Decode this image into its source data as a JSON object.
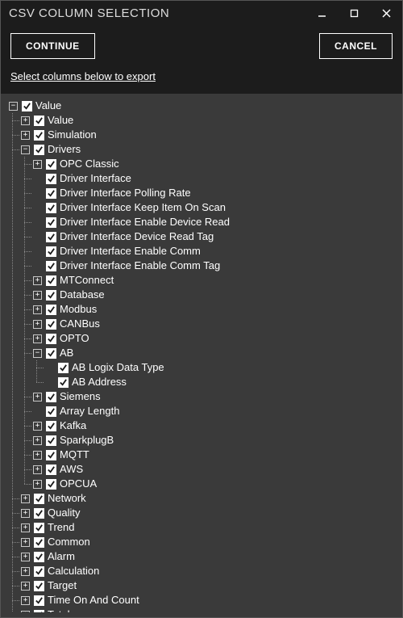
{
  "window": {
    "title": "CSV COLUMN SELECTION"
  },
  "buttons": {
    "continue": "CONTINUE",
    "cancel": "CANCEL"
  },
  "instruction": "Select columns below to export",
  "tree": [
    {
      "label": "Value",
      "checked": true,
      "expanded": true,
      "children": [
        {
          "label": "Value",
          "checked": true,
          "expandable": true,
          "expanded": false
        },
        {
          "label": "Simulation",
          "checked": true,
          "expandable": true,
          "expanded": false
        },
        {
          "label": "Drivers",
          "checked": true,
          "expanded": true,
          "children": [
            {
              "label": "OPC Classic",
              "checked": true,
              "expandable": true,
              "expanded": false
            },
            {
              "label": "Driver Interface",
              "checked": true
            },
            {
              "label": "Driver Interface Polling Rate",
              "checked": true
            },
            {
              "label": "Driver Interface Keep Item On Scan",
              "checked": true
            },
            {
              "label": "Driver Interface Enable Device Read",
              "checked": true
            },
            {
              "label": "Driver Interface Device Read Tag",
              "checked": true
            },
            {
              "label": "Driver Interface Enable Comm",
              "checked": true
            },
            {
              "label": "Driver Interface Enable Comm Tag",
              "checked": true
            },
            {
              "label": "MTConnect",
              "checked": true,
              "expandable": true,
              "expanded": false
            },
            {
              "label": "Database",
              "checked": true,
              "expandable": true,
              "expanded": false
            },
            {
              "label": "Modbus",
              "checked": true,
              "expandable": true,
              "expanded": false
            },
            {
              "label": "CANBus",
              "checked": true,
              "expandable": true,
              "expanded": false
            },
            {
              "label": "OPTO",
              "checked": true,
              "expandable": true,
              "expanded": false
            },
            {
              "label": "AB",
              "checked": true,
              "expanded": true,
              "children": [
                {
                  "label": "AB Logix Data Type",
                  "checked": true
                },
                {
                  "label": "AB Address",
                  "checked": true
                }
              ]
            },
            {
              "label": "Siemens",
              "checked": true,
              "expandable": true,
              "expanded": false
            },
            {
              "label": "Array Length",
              "checked": true
            },
            {
              "label": "Kafka",
              "checked": true,
              "expandable": true,
              "expanded": false
            },
            {
              "label": "SparkplugB",
              "checked": true,
              "expandable": true,
              "expanded": false
            },
            {
              "label": "MQTT",
              "checked": true,
              "expandable": true,
              "expanded": false
            },
            {
              "label": "AWS",
              "checked": true,
              "expandable": true,
              "expanded": false
            },
            {
              "label": "OPCUA",
              "checked": true,
              "expandable": true,
              "expanded": false
            }
          ]
        },
        {
          "label": "Network",
          "checked": true,
          "expandable": true,
          "expanded": false
        },
        {
          "label": "Quality",
          "checked": true,
          "expandable": true,
          "expanded": false
        },
        {
          "label": "Trend",
          "checked": true,
          "expandable": true,
          "expanded": false
        },
        {
          "label": "Common",
          "checked": true,
          "expandable": true,
          "expanded": false
        },
        {
          "label": "Alarm",
          "checked": true,
          "expandable": true,
          "expanded": false
        },
        {
          "label": "Calculation",
          "checked": true,
          "expandable": true,
          "expanded": false
        },
        {
          "label": "Target",
          "checked": true,
          "expandable": true,
          "expanded": false
        },
        {
          "label": "Time On And Count",
          "checked": true,
          "expandable": true,
          "expanded": false
        },
        {
          "label": "Total",
          "checked": true,
          "expandable": true,
          "expanded": false
        }
      ]
    }
  ]
}
